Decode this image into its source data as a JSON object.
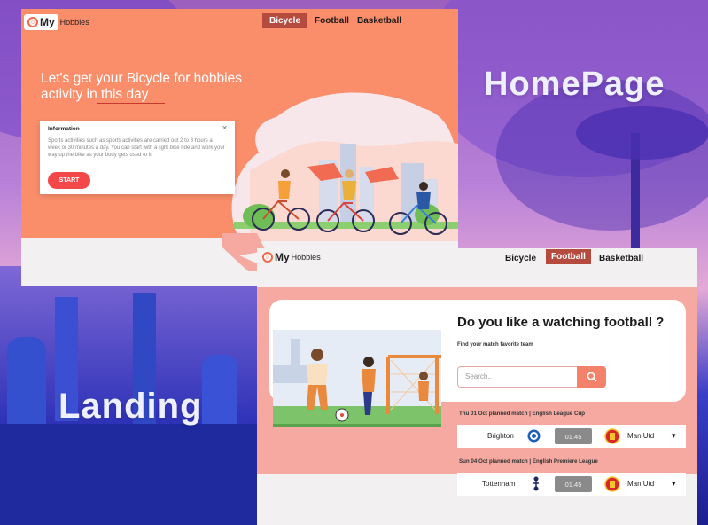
{
  "overlay": {
    "homepage_title": "HomePage",
    "landing_title": "Landing"
  },
  "home": {
    "logo": {
      "my": "My",
      "hobbies": "Hobbies"
    },
    "nav": [
      {
        "label": "Bicycle"
      },
      {
        "label": "Football"
      },
      {
        "label": "Basketball"
      }
    ],
    "active_nav": "Bicycle",
    "hero_line1": "Let's get your Bicycle for hobbies",
    "hero_line2": "activity in this day",
    "info": {
      "title": "Information",
      "text": "Sports activities such as sports activities are carried out 2 to 3 hours a week or 30 minutes a day. You can start with a light bike ride and work your way up the bike as your body gets used to it",
      "start_label": "START"
    }
  },
  "landing": {
    "logo": {
      "my": "My",
      "hobbies": "Hobbies"
    },
    "nav": [
      {
        "label": "Bicycle"
      },
      {
        "label": "Football"
      },
      {
        "label": "Basketball"
      }
    ],
    "active_nav": "Football",
    "question": "Do you like a watching football ?",
    "subtitle": "Find your match favorite team",
    "search_placeholder": "Search..",
    "matches": [
      {
        "header": "Thu 01 Oct planned match | English League Cup",
        "home": "Brighton",
        "score": "01.45",
        "away": "Man Utd"
      },
      {
        "header": "Sun 04 Oct planned match | English Premiere League",
        "home": "Tottenham",
        "score": "01.45",
        "away": "Man Utd"
      }
    ]
  },
  "colors": {
    "coral": "#fa8d6a",
    "accent_red": "#b54a3f",
    "start_red": "#f3474a",
    "pink_band": "#f5a9a0"
  }
}
